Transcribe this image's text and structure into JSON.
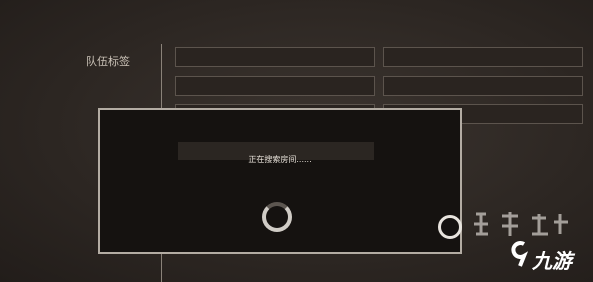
{
  "header": {
    "title": ""
  },
  "form": {
    "team_tag_label": "队伍标签"
  },
  "modal": {
    "field_label": "",
    "field_value": "",
    "status_text": "正在搜索房间......"
  },
  "watermark": {
    "logo_text": "九游",
    "colors": {
      "accent": "#e8e4de"
    }
  }
}
